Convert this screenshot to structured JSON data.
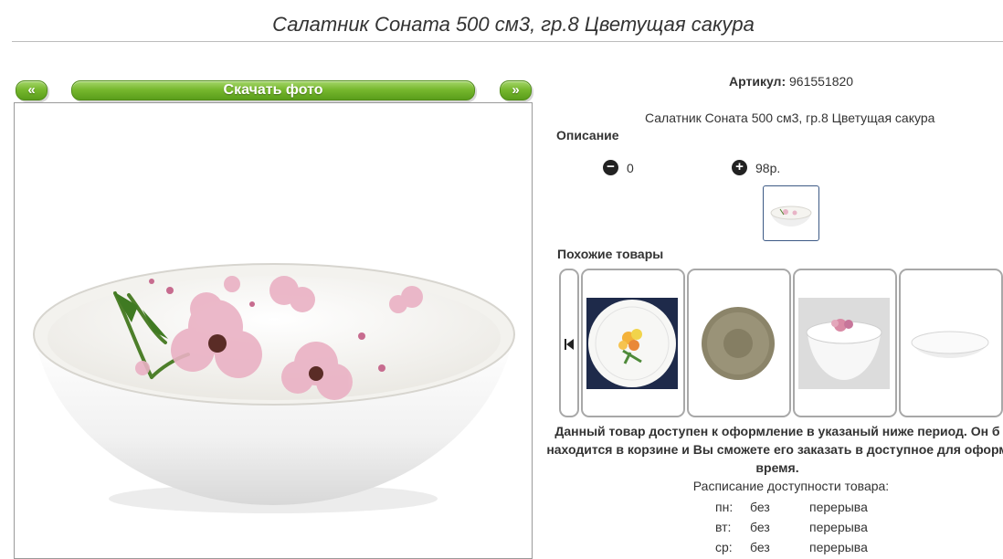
{
  "page": {
    "title": "Салатник Соната 500 см3, гр.8 Цветущая сакура"
  },
  "gallery": {
    "prev_label": "«",
    "download_label": "Скачать фото",
    "next_label": "»"
  },
  "product": {
    "article_label": "Артикул:",
    "article_value": "961551820",
    "name_line": "Салатник Соната 500 см3, гр.8 Цветущая сакура",
    "description_label": "Описание",
    "qty_value": "0",
    "price": "98р."
  },
  "similar": {
    "heading": "Похожие товары"
  },
  "availability": {
    "notice_line1": "Данный товар доступен к оформление в указаный ниже период. Он б",
    "notice_line2": "находится в корзине и Вы сможете его заказать в доступное для оформ",
    "notice_line3": "время.",
    "schedule_title": "Расписание доступности товара:",
    "rows": [
      {
        "day": "пн:",
        "from": "без",
        "to": "перерыва"
      },
      {
        "day": "вт:",
        "from": "без",
        "to": "перерыва"
      },
      {
        "day": "ср:",
        "from": "без",
        "to": "перерыва"
      }
    ]
  },
  "colors": {
    "button_green": "#77b82e",
    "border_gray": "#a8a8a8",
    "thumb_border": "#3d5a85"
  }
}
